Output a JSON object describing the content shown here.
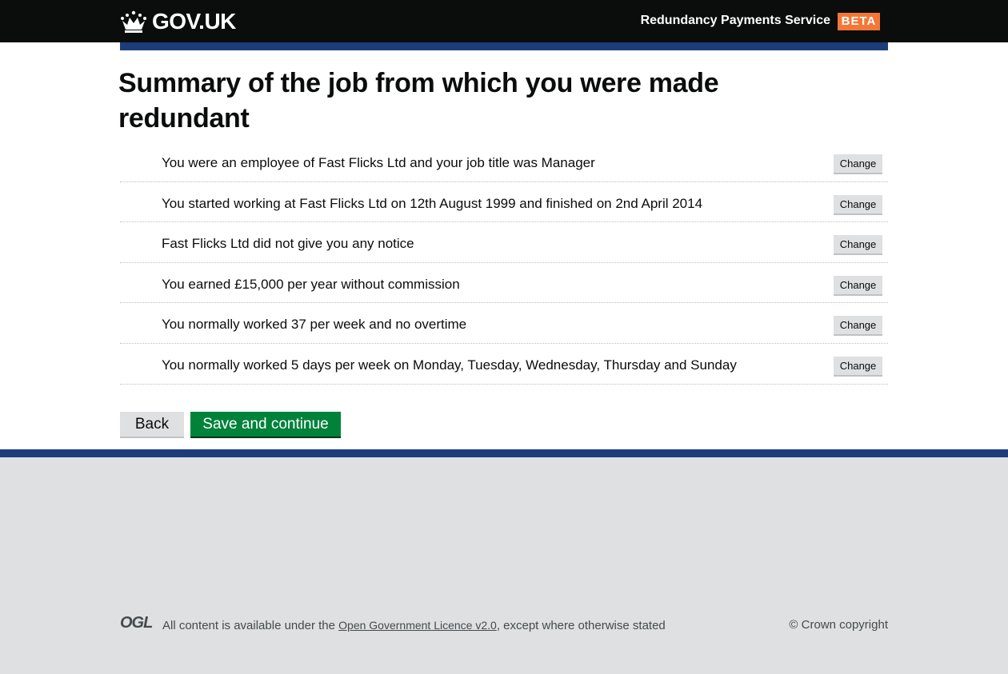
{
  "header": {
    "logo_text": "GOV.UK",
    "service_name": "Redundancy Payments Service",
    "phase_tag": "BETA"
  },
  "main": {
    "title": "Summary of the job from which you were made redundant",
    "rows": [
      {
        "text": "You were an employee of Fast Flicks Ltd and your job title was Manager",
        "action": "Change"
      },
      {
        "text": "You started working at Fast Flicks Ltd on 12th August 1999 and finished on 2nd April 2014",
        "action": "Change"
      },
      {
        "text": "Fast Flicks Ltd did not give you any notice",
        "action": "Change"
      },
      {
        "text": "You earned £15,000 per year without commission",
        "action": "Change"
      },
      {
        "text": "You normally worked 37 per week and no overtime",
        "action": "Change"
      },
      {
        "text": "You normally worked 5 days per week on Monday, Tuesday, Wednesday, Thursday and Sunday",
        "action": "Change"
      }
    ],
    "back_label": "Back",
    "save_label": "Save and continue"
  },
  "footer": {
    "ogl_logo": "OGL",
    "licence_prefix": "All content is available under the ",
    "licence_link": "Open Government Licence v2.0",
    "licence_suffix": ", except where otherwise stated",
    "copyright": "© Crown copyright"
  },
  "colors": {
    "header_bg": "#0b0c0c",
    "brand_blue": "#1d3d7a",
    "beta_tag": "#f47738",
    "primary_button": "#00823b",
    "footer_bg": "#dee0e2"
  }
}
